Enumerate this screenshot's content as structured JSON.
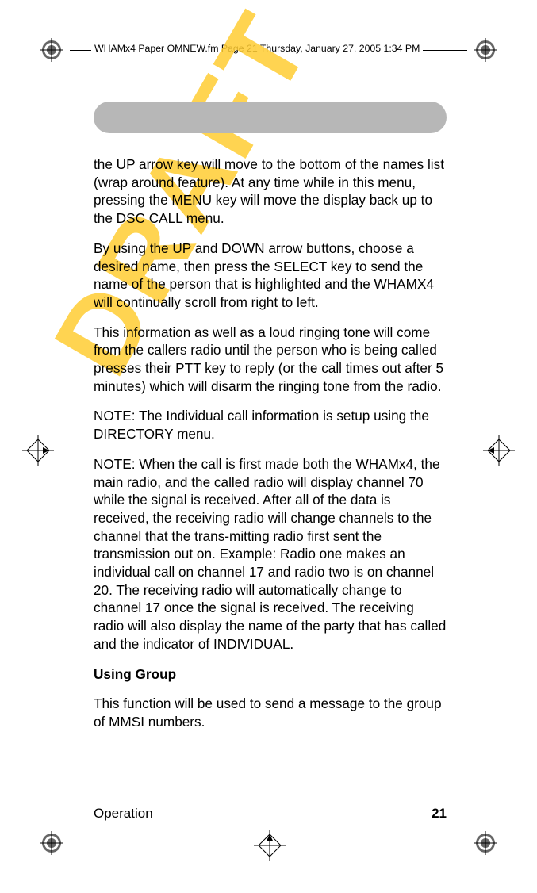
{
  "header": {
    "text": "WHAMx4 Paper OMNEW.fm  Page 21  Thursday, January 27, 2005  1:34 PM"
  },
  "watermark": "DRAFT",
  "paragraphs": {
    "p1": "the UP arrow key will move to the bottom of the names list (wrap around feature). At any time while in this menu, pressing the MENU key will move the display back up to the DSC CALL menu.",
    "p2": "By using the UP and DOWN arrow buttons, choose a desired name, then press the SELECT key to send the name of the person that is highlighted and the WHAMX4 will continually scroll from right to left.",
    "p3": "This information as well as a loud ringing tone will come from the callers radio until the person who is being called presses their PTT key to reply (or the call times out after 5 minutes) which will disarm the ringing tone from the radio.",
    "p4": "NOTE: The Individual call information is setup using the DIRECTORY menu.",
    "p5": "NOTE:  When the call is first made both the WHAMx4, the main radio, and the called radio will display channel 70 while the signal is received.  After all of the data is received, the receiving radio will change channels to the channel that the trans-mitting radio first sent the transmission out on.  Example:  Radio one makes an individual call on channel 17 and radio two is on channel 20.  The receiving radio will automatically change to channel 17 once the signal is received.  The receiving radio will also display the name of the party that has called and the indicator of INDIVIDUAL.",
    "h1": "Using Group",
    "p6": "This function will be used to send a message to the group of MMSI numbers."
  },
  "footer": {
    "section": "Operation",
    "page": "21"
  }
}
